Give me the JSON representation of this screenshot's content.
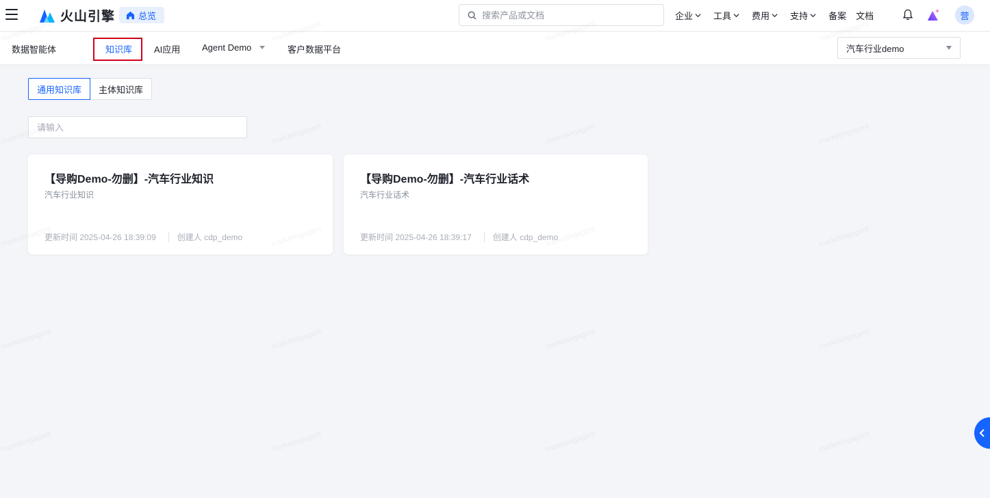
{
  "header": {
    "brand": "火山引擎",
    "overview_label": "总览",
    "search_placeholder": "搜索产品或文档",
    "nav": [
      {
        "label": "企业"
      },
      {
        "label": "工具"
      },
      {
        "label": "费用"
      },
      {
        "label": "支持"
      }
    ],
    "links": [
      "备案",
      "文档"
    ],
    "avatar_text": "营"
  },
  "subnav": {
    "tabs": [
      "数据智能体",
      "知识库",
      "AI应用",
      "Agent Demo",
      "客户数据平台"
    ],
    "active_tab": "知识库",
    "scope_select": "汽车行业demo"
  },
  "main": {
    "segments": [
      "通用知识库",
      "主体知识库"
    ],
    "active_segment": "通用知识库",
    "search_placeholder": "请输入",
    "cards": [
      {
        "title": "【导购Demo-勿删】-汽车行业知识",
        "description": "汽车行业知识",
        "updated": "更新时间 2025-04-26 18:39:09",
        "creator": "创建人 cdp_demo"
      },
      {
        "title": "【导购Demo-勿删】-汽车行业话术",
        "description": "汽车行业话术",
        "updated": "更新时间 2025-04-26 18:39:17",
        "creator": "创建人 cdp_demo"
      }
    ]
  },
  "watermark_text": "marketingagent",
  "colors": {
    "accent": "#1664ff",
    "highlight_box": "#d0021b",
    "background": "#f3f5f8"
  }
}
